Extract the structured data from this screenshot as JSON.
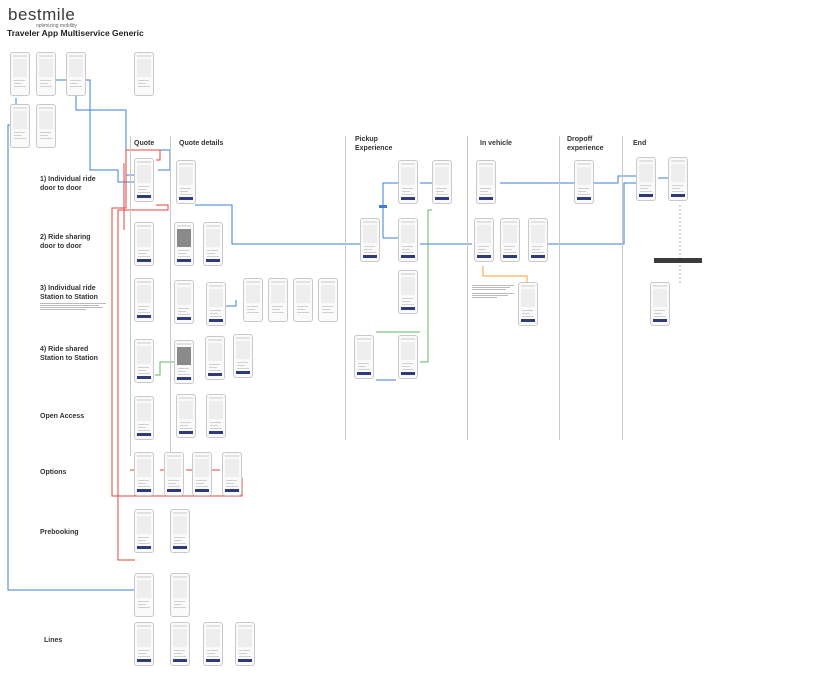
{
  "header": {
    "logo_word": "bestmile",
    "logo_tagline": "optimizing mobility",
    "title": "Traveler App Multiservice Generic"
  },
  "columns": {
    "quote": "Quote",
    "quote_details": "Quote details",
    "pickup": "Pickup\nExperience",
    "in_vehicle": "In vehicle",
    "dropoff": "Dropoff\nexperience",
    "end": "End"
  },
  "rows": {
    "r1": "1) Individual ride\ndoor to door",
    "r2": "2) Ride sharing\ndoor to door",
    "r3": "3) Individual ride\nStation to Station",
    "r4": "4) Ride shared\nStation to Station",
    "open_access": "Open Access",
    "options": "Options",
    "prebooking": "Prebooking",
    "lines": "Lines"
  },
  "colors": {
    "blue_link": "#3d7fd6",
    "red_link": "#e0463c",
    "green_link": "#5cb85c",
    "orange_link": "#f0a030",
    "grey_link": "#b0b0b0",
    "button_navy": "#2f3a7a"
  }
}
